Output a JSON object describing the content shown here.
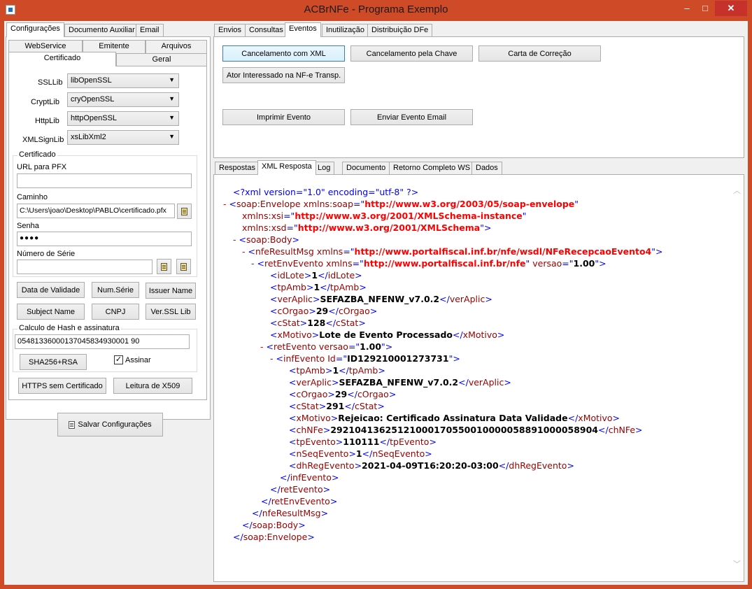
{
  "window": {
    "title": "ACBrNFe - Programa Exemplo",
    "min": "–",
    "max": "□",
    "close": "✕"
  },
  "left": {
    "top_tabs": [
      "Configurações",
      "Documento Auxiliar",
      "Email"
    ],
    "sub_tabs_row1": [
      "WebService",
      "Emitente",
      "Arquivos"
    ],
    "sub_tabs_row2": [
      "Certificado",
      "Geral"
    ],
    "ssl": {
      "ssllib_label": "SSLLib",
      "ssllib_value": "libOpenSSL",
      "cryptlib_label": "CryptLib",
      "cryptlib_value": "cryOpenSSL",
      "httplib_label": "HttpLib",
      "httplib_value": "httpOpenSSL",
      "xmlsign_label": "XMLSignLib",
      "xmlsign_value": "xsLibXml2"
    },
    "cert": {
      "group_label": "Certificado",
      "url_label": "URL para PFX",
      "url_value": "",
      "path_label": "Caminho",
      "path_value": "C:\\Users\\joao\\Desktop\\PABLO\\certificado.pfx",
      "pass_label": "Senha",
      "pass_value": "●●●●",
      "serial_label": "Número de Série",
      "serial_value": ""
    },
    "buttons": {
      "data_validade": "Data de Validade",
      "num_serie": "Num.Série",
      "issuer": "Issuer Name",
      "subject": "Subject Name",
      "cnpj": "CNPJ",
      "ver_ssl": "Ver.SSL Lib"
    },
    "hash": {
      "group_label": "Calculo de Hash e assinatura",
      "value": "05481336000137045834930001 90",
      "sha_button": "SHA256+RSA",
      "assinar_label": "Assinar",
      "assinar_check": "✓"
    },
    "https_button": "HTTPS sem Certificado",
    "x509_button": "Leitura de X509",
    "save_button": "Salvar Configurações"
  },
  "right": {
    "top_tabs": [
      "Envios",
      "Consultas",
      "Eventos",
      "Inutilização",
      "Distribuição DFe"
    ],
    "event_buttons": {
      "cancel_xml": "Cancelamento com XML",
      "cancel_chave": "Cancelamento pela Chave",
      "carta": "Carta de Correção",
      "ator": "Ator Interessado na NF-e Transp.",
      "imprimir": "Imprimir Evento",
      "email": "Enviar Evento Email"
    },
    "resp_tabs": [
      "Respostas",
      "XML Resposta",
      "Log",
      "Documento",
      "Retorno Completo WS",
      "Dados"
    ],
    "xml": {
      "l1": "<?xml version=\"1.0\" encoding=\"utf-8\" ?>",
      "env_tag": "soap:Envelope",
      "ns_soap_attr": "xmlns:soap",
      "ns_soap_val": "http://www.w3.org/2003/05/soap-envelope",
      "ns_xsi_attr": "xmlns:xsi",
      "ns_xsi_val": "http://www.w3.org/2001/XMLSchema-instance",
      "ns_xsd_attr": "xmlns:xsd",
      "ns_xsd_val": "http://www.w3.org/2001/XMLSchema",
      "body_tag": "soap:Body",
      "nfe_tag": "nfeResultMsg",
      "nfe_attr": "xmlns",
      "nfe_val": "http://www.portalfiscal.inf.br/nfe/wsdl/NFeRecepcaoEvento4",
      "ret_tag": "retEnvEvento",
      "ret_attr": "xmlns",
      "ret_val": "http://www.portalfiscal.inf.br/nfe",
      "ret_attr2": "versao",
      "ret_val2": "1.00",
      "idLote": "1",
      "tpAmb": "1",
      "verAplic": "SEFAZBA_NFENW_v7.0.2",
      "cOrgao": "29",
      "cStat": "128",
      "xMotivo": "Lote de Evento Processado",
      "retEvento_attr": "versao",
      "retEvento_val": "1.00",
      "inf_attr": "Id",
      "inf_val": "ID129210001273731",
      "e_tpAmb": "1",
      "e_verAplic": "SEFAZBA_NFENW_v7.0.2",
      "e_cOrgao": "29",
      "e_cStat": "291",
      "e_xMotivo": "Rejeicao: Certificado Assinatura Data Validade",
      "e_chNFe": "29210413625121000170550010000058891000058904",
      "e_tpEvento": "110111",
      "e_nSeqEvento": "1",
      "e_dhRegEvento": "2021-04-09T16:20:20-03:00"
    }
  }
}
